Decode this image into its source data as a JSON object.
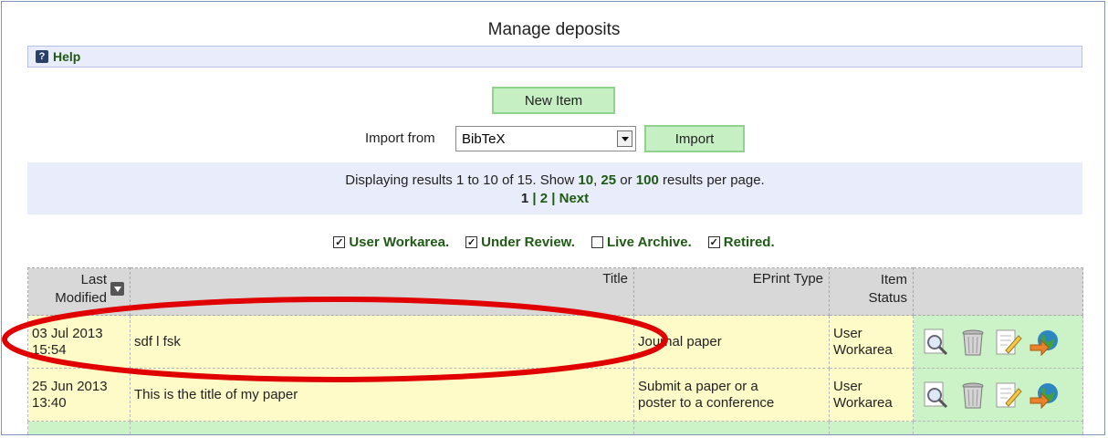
{
  "page": {
    "title": "Manage deposits",
    "help": "Help"
  },
  "toolbar": {
    "new_item": "New Item",
    "import_label": "Import from",
    "import_selected": "BibTeX",
    "import_button": "Import"
  },
  "results": {
    "prefix": "Displaying results 1 to 10 of 15. Show ",
    "opt1": "10",
    "sep1": ", ",
    "opt2": "25",
    "sep2": " or ",
    "opt3": "100",
    "suffix": " results per page.",
    "page1": "1",
    "page2": "2",
    "next": "Next"
  },
  "filters": [
    {
      "label": "User Workarea.",
      "checked": true
    },
    {
      "label": "Under Review.",
      "checked": true
    },
    {
      "label": "Live Archive.",
      "checked": false
    },
    {
      "label": "Retired.",
      "checked": true
    }
  ],
  "table": {
    "headers": {
      "modified_line1": "Last",
      "modified_line2": "Modified",
      "title": "Title",
      "type": "EPrint Type",
      "status_line1": "Item",
      "status_line2": "Status"
    },
    "rows": [
      {
        "date_line1": "03 Jul 2013",
        "date_line2": "15:54",
        "title": "sdf l fsk",
        "type_line1": "Journal paper",
        "type_line2": "",
        "status_line1": "User",
        "status_line2": "Workarea"
      },
      {
        "date_line1": "25 Jun 2013",
        "date_line2": "13:40",
        "title": "This is the title of my paper",
        "type_line1": "Submit a paper or a",
        "type_line2": "poster to a conference",
        "status_line1": "User",
        "status_line2": "Workarea"
      }
    ]
  },
  "colors": {
    "accent_green": "#1f5a14",
    "button_bg": "#c6efc4",
    "bar_bg": "#e9ecfa",
    "highlight_ellipse": "#e00000"
  }
}
